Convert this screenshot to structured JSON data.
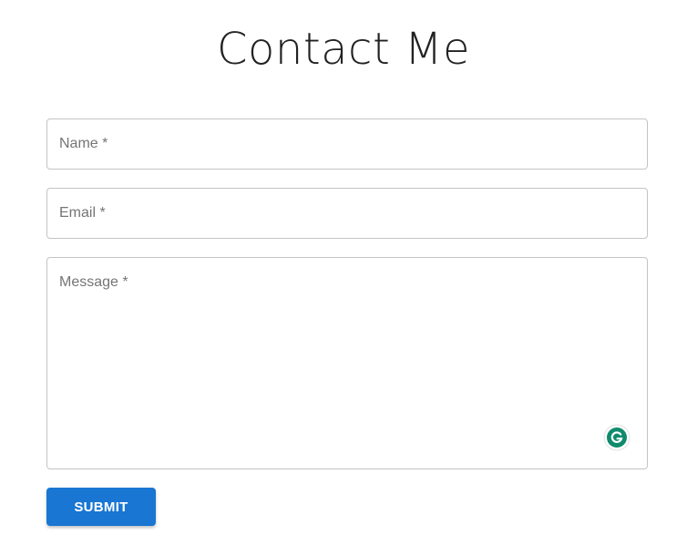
{
  "page": {
    "title": "Contact Me"
  },
  "form": {
    "name_placeholder": "Name *",
    "email_placeholder": "Email *",
    "message_placeholder": "Message *",
    "submit_label": "SUBMIT"
  },
  "icons": {
    "grammarly": "grammarly-icon"
  },
  "colors": {
    "accent": "#1976d2",
    "grammarly": "#15c39a",
    "border": "#c4c4c4",
    "placeholder": "#757575"
  }
}
